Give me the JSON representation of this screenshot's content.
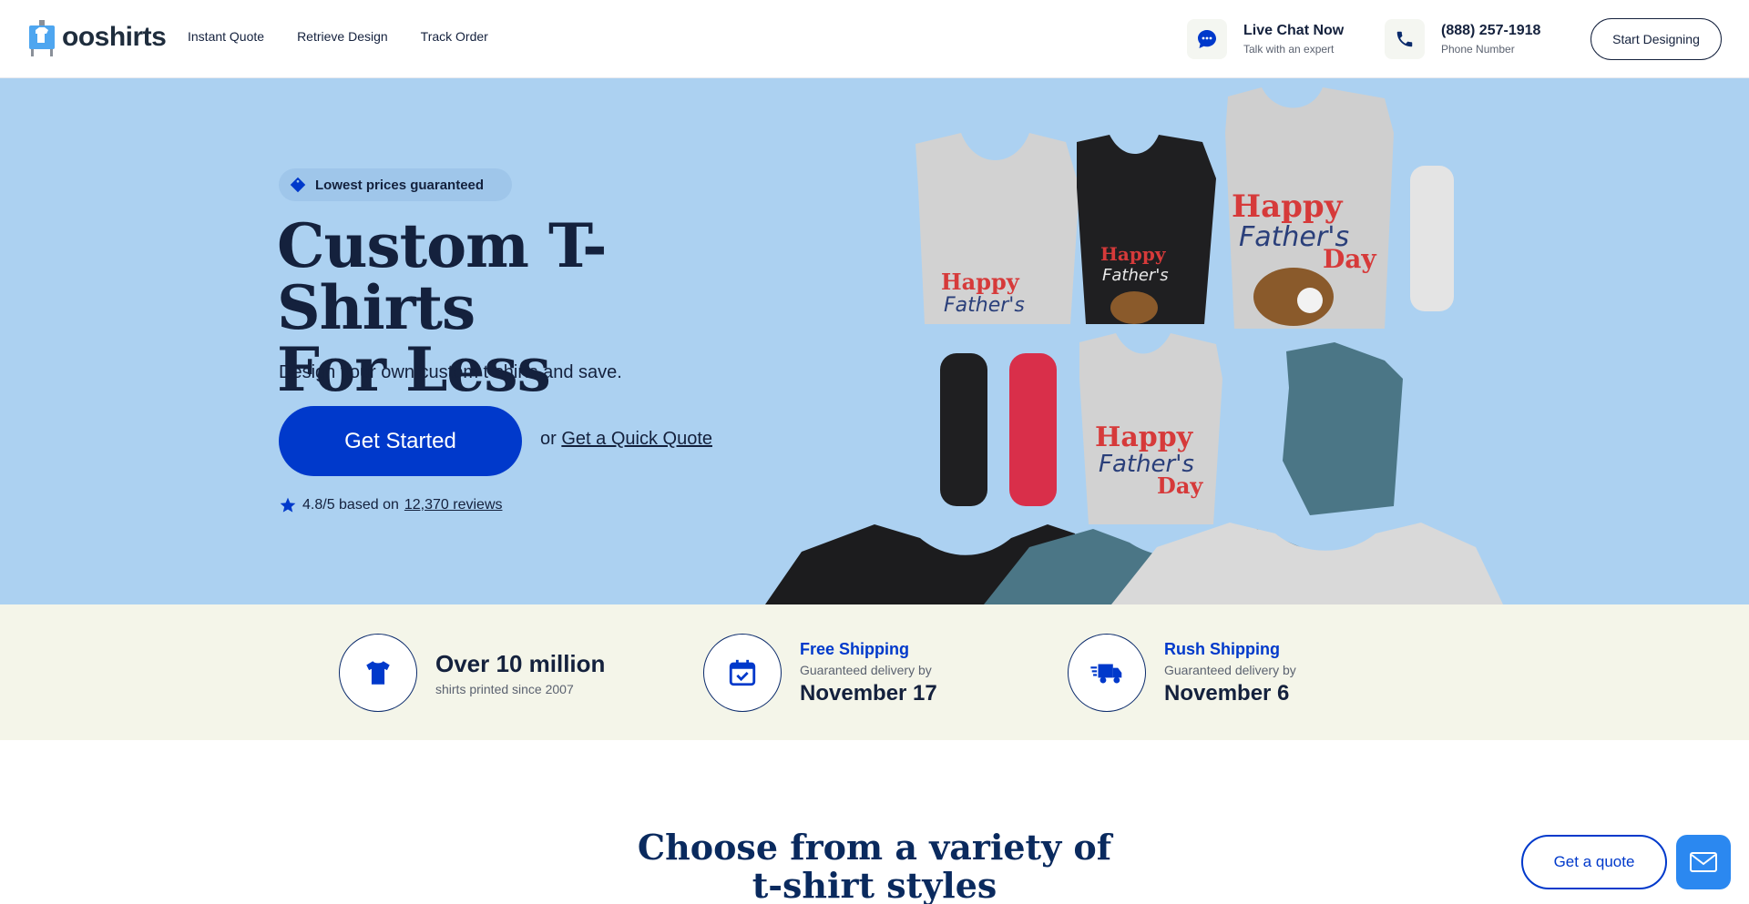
{
  "header": {
    "logo_text": "ooshirts",
    "nav": [
      {
        "label": "Instant Quote"
      },
      {
        "label": "Retrieve Design"
      },
      {
        "label": "Track Order"
      }
    ],
    "chat": {
      "title": "Live Chat Now",
      "subtitle": "Talk with an expert",
      "icon": "chat-icon"
    },
    "phone": {
      "title": "(888) 257-1918",
      "subtitle": "Phone Number",
      "icon": "phone-icon"
    },
    "start_button": "Start Designing"
  },
  "hero": {
    "pill": "Lowest prices guaranteed",
    "title_line1": "Custom T-Shirts",
    "title_line2": "For Less",
    "subtitle": "Design your own custom t-shirts and save.",
    "cta": "Get Started",
    "quick_prefix": "or",
    "quick_link": "Get a Quick Quote",
    "rating_text": "4.8/5 based on",
    "reviews_link": "12,370 reviews",
    "shirt_text": {
      "line1": "Happy",
      "line2": "Father's",
      "line3": "Day"
    }
  },
  "stats": [
    {
      "icon": "tshirt-icon",
      "big": "Over 10 million",
      "small": "shirts printed since 2007"
    },
    {
      "icon": "calendar-check-icon",
      "label": "Free Shipping",
      "small": "Guaranteed delivery by",
      "date": "November 17"
    },
    {
      "icon": "truck-icon",
      "label": "Rush Shipping",
      "small": "Guaranteed delivery by",
      "date": "November 6"
    }
  ],
  "section": {
    "title_line1": "Choose from a variety of",
    "title_line2": "t-shirt styles"
  },
  "floating": {
    "quote": "Get a quote",
    "mail_icon": "mail-icon"
  },
  "colors": {
    "primary": "#0039cb",
    "hero_bg": "#acd1f1",
    "band_bg": "#f4f5e9",
    "navy": "#14213d"
  }
}
